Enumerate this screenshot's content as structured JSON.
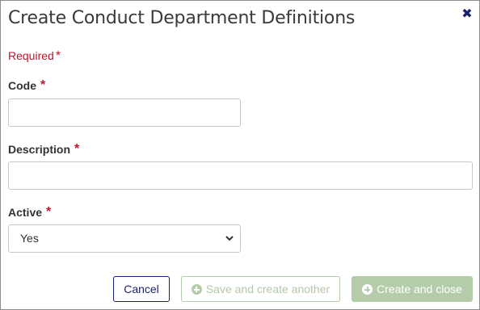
{
  "dialog": {
    "title": "Create Conduct Department Definitions",
    "close_icon": "close-icon"
  },
  "form": {
    "required_note": "Required",
    "required_marker": "*",
    "fields": {
      "code": {
        "label": "Code",
        "value": ""
      },
      "description": {
        "label": "Description",
        "value": ""
      },
      "active": {
        "label": "Active",
        "selected": "Yes"
      }
    }
  },
  "actions": {
    "cancel": "Cancel",
    "save_another": "Save and create another",
    "create_close": "Create and close",
    "save_icon": "plus-circle-icon",
    "create_icon": "plus-circle-icon"
  },
  "colors": {
    "accent": "#1b1f6e",
    "required": "#c0142c",
    "disabled_green": "#b5ccaa"
  }
}
